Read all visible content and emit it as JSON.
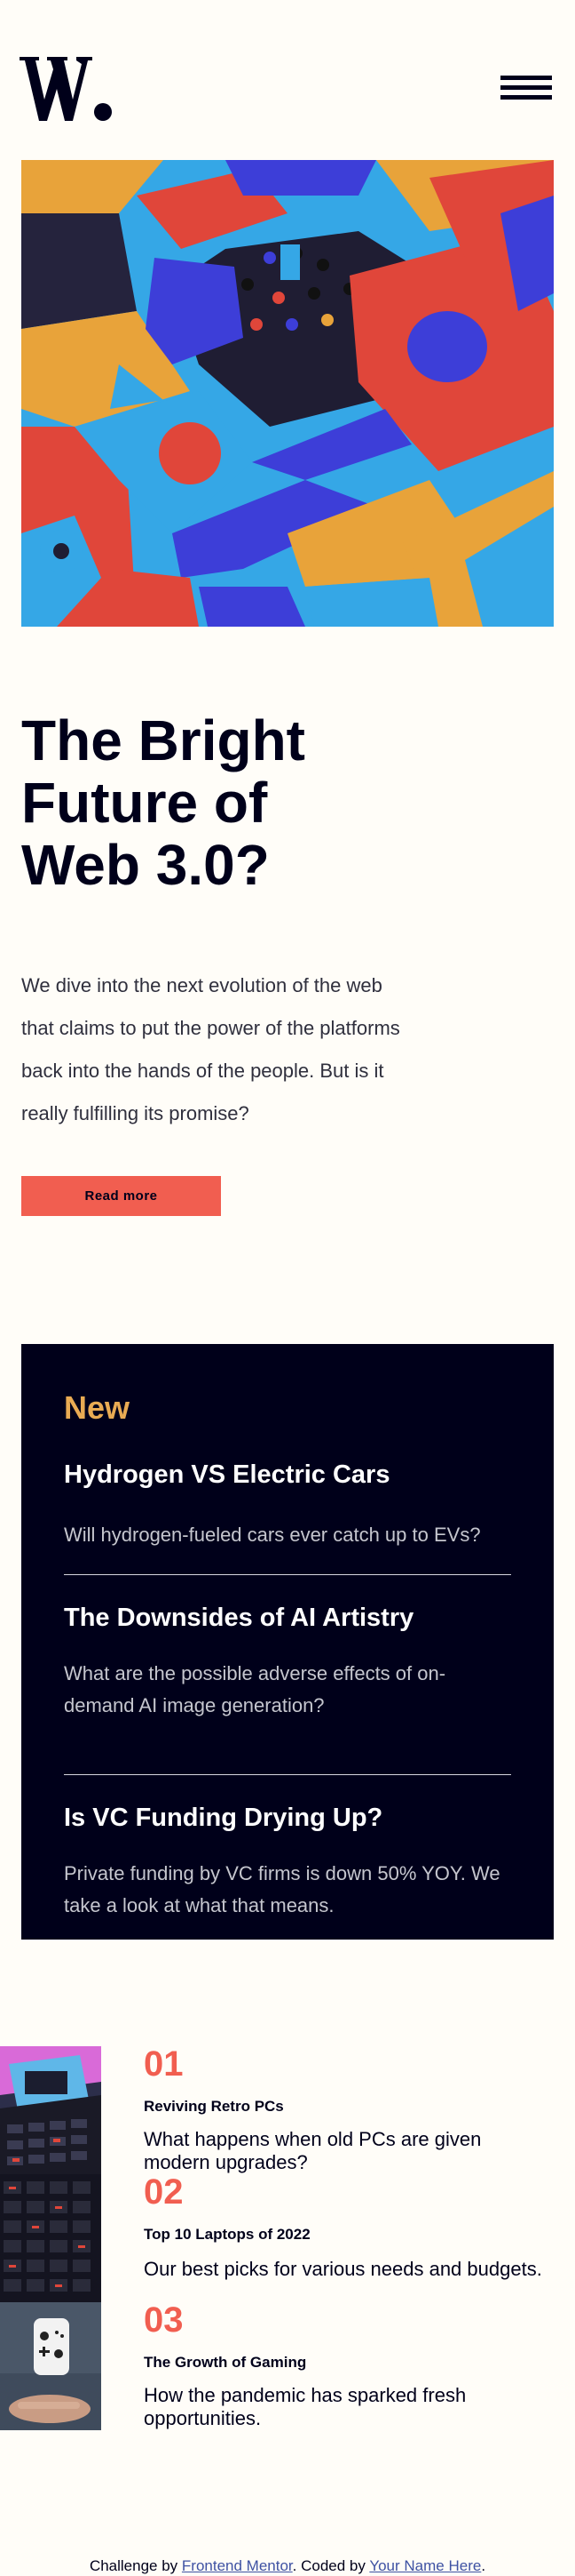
{
  "header": {
    "logo_text": "W.",
    "menu_icon": "hamburger-menu-icon"
  },
  "hero": {
    "headline": "The Bright Future of Web 3.0?",
    "intro": "We dive into the next evolution of the web that claims to put the power of the platforms back into the hands of the people. But is it really fulfilling its promise?",
    "cta_label": "Read more"
  },
  "new_section": {
    "title": "New",
    "items": [
      {
        "title": "Hydrogen VS Electric Cars",
        "desc": "Will hydrogen-fueled cars ever catch up to EVs?"
      },
      {
        "title": "The Downsides of AI Artistry",
        "desc": "What are the possible adverse effects of on-demand AI image generation?"
      },
      {
        "title": "Is VC Funding Drying Up?",
        "desc": "Private funding by VC firms is down 50% YOY. We take a look at what that means."
      }
    ]
  },
  "numbered_list": {
    "items": [
      {
        "num": "01",
        "title": "Reviving Retro PCs",
        "desc": "What happens when old PCs are given modern upgrades?"
      },
      {
        "num": "02",
        "title": "Top 10 Laptops of 2022",
        "desc": "Our best picks for various needs and budgets."
      },
      {
        "num": "03",
        "title": "The Growth of Gaming",
        "desc": "How the pandemic has sparked fresh opportunities."
      }
    ]
  },
  "footer": {
    "prefix": "Challenge by",
    "link1": "Frontend Mentor",
    "middle": ". Coded by",
    "link2": "Your Name Here",
    "suffix": "."
  },
  "colors": {
    "background": "#fffdf8",
    "dark": "#00001a",
    "accent_red": "#f15e50",
    "accent_orange": "#e9ab53"
  }
}
